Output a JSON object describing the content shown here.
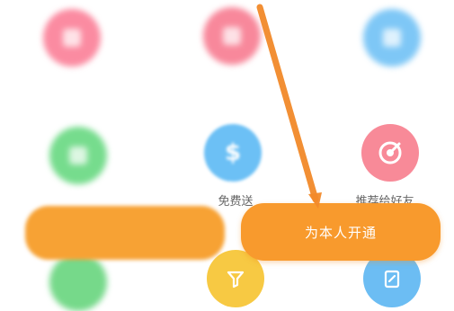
{
  "grid": {
    "row1": [
      {
        "icon": "pink-gift-icon",
        "label": "",
        "color": "#fb8ba1"
      },
      {
        "icon": "rose-ticket-icon",
        "label": "",
        "color": "#f8889b"
      },
      {
        "icon": "blue-crown-icon",
        "label": "",
        "color": "#7ec7f6"
      }
    ],
    "row2": [
      {
        "icon": "green-music-icon",
        "label": "",
        "color": "#76dc8d"
      },
      {
        "icon": "blue-dollar-icon",
        "label": "免费送",
        "color": "#6cc0f5"
      },
      {
        "icon": "pink-target-icon",
        "label": "推荐给好友",
        "color": "#f88a98"
      }
    ],
    "row3": [
      {
        "icon": "green-icon",
        "color": "#76d98a"
      },
      {
        "icon": "yellow-filter-icon",
        "color": "#f7c943"
      },
      {
        "icon": "blue-edit-icon",
        "color": "#6cbdf3"
      }
    ]
  },
  "buttons": {
    "gift_label": "",
    "open_self_label": "为本人开通"
  },
  "annotation": {
    "arrow_color": "#f28a2a"
  }
}
